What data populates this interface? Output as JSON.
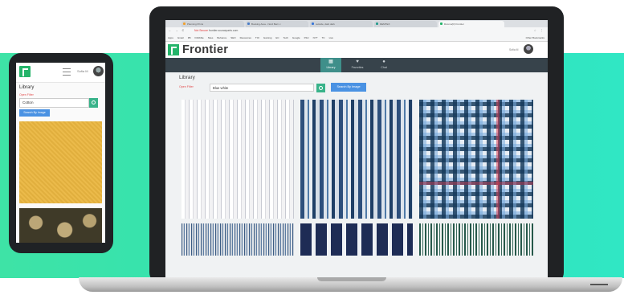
{
  "phone": {
    "username": "Sofia M",
    "library_title": "Library",
    "open_filter": "Open Filter",
    "search_value": "Cotton",
    "search_by_image": "Search By Image"
  },
  "browser": {
    "tabs": [
      {
        "label": "Planning Prints",
        "active": false,
        "color": "#f0a030"
      },
      {
        "label": "Booking Area - Nord Bern x",
        "active": false,
        "color": "#4a7cc7"
      },
      {
        "label": "outside, dark dark",
        "active": false,
        "color": "#3b78d8"
      },
      {
        "label": "DEMTEX",
        "active": false,
        "color": "#2a9d8f"
      },
      {
        "label": "Dcomo(R) Frontier",
        "active": true,
        "color": "#25b46a"
      }
    ],
    "address": {
      "warning": "Not Secure",
      "url": "frontier.sourceparts.com"
    },
    "bookmarks": [
      "Apps",
      "Gmail",
      "FB",
      "Dribbble",
      "Sites",
      "Behance",
      "SEO",
      "Resources",
      "TOI",
      "Gaming",
      "EC",
      "Tech",
      "Google",
      "FSU",
      "NYT",
      "TC",
      "Live"
    ],
    "other_bookmarks": "Other Bookmarks"
  },
  "app": {
    "brand": "Frontier",
    "username": "Sofia M",
    "nav": [
      {
        "label": "Library",
        "icon": "▦",
        "active": true
      },
      {
        "label": "Favorites",
        "icon": "♥",
        "active": false
      },
      {
        "label": "Chat",
        "icon": "●",
        "active": false
      }
    ],
    "library_title": "Library",
    "open_filter": "Open Filter",
    "search_value": "Blue white",
    "search_by_image": "Search By Image"
  },
  "colors": {
    "brand_green": "#25b46a",
    "nav_dark": "#37434b",
    "nav_active": "#3f8f8a",
    "search_button": "#39b38a",
    "image_search_button": "#4a92e3",
    "background_band": "#32e3b2"
  }
}
